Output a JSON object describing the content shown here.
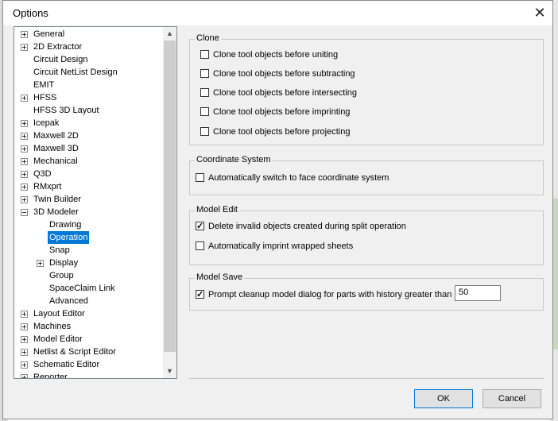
{
  "window": {
    "title": "Options",
    "close_glyph": "✕"
  },
  "tree": {
    "nodes": [
      {
        "label": "General",
        "expander": "plus",
        "indent": 0
      },
      {
        "label": "2D Extractor",
        "expander": "plus",
        "indent": 0
      },
      {
        "label": "Circuit Design",
        "expander": "none",
        "indent": 0
      },
      {
        "label": "Circuit NetList Design",
        "expander": "none",
        "indent": 0
      },
      {
        "label": "EMIT",
        "expander": "none",
        "indent": 0
      },
      {
        "label": "HFSS",
        "expander": "plus",
        "indent": 0
      },
      {
        "label": "HFSS 3D Layout",
        "expander": "none",
        "indent": 0
      },
      {
        "label": "Icepak",
        "expander": "plus",
        "indent": 0
      },
      {
        "label": "Maxwell 2D",
        "expander": "plus",
        "indent": 0
      },
      {
        "label": "Maxwell 3D",
        "expander": "plus",
        "indent": 0
      },
      {
        "label": "Mechanical",
        "expander": "plus",
        "indent": 0
      },
      {
        "label": "Q3D",
        "expander": "plus",
        "indent": 0
      },
      {
        "label": "RMxprt",
        "expander": "plus",
        "indent": 0
      },
      {
        "label": "Twin Builder",
        "expander": "plus",
        "indent": 0
      },
      {
        "label": "3D Modeler",
        "expander": "minus",
        "indent": 0
      },
      {
        "label": "Drawing",
        "expander": "none",
        "indent": 1
      },
      {
        "label": "Operation",
        "expander": "none",
        "indent": 1,
        "selected": true
      },
      {
        "label": "Snap",
        "expander": "none",
        "indent": 1
      },
      {
        "label": "Display",
        "expander": "plus",
        "indent": 1
      },
      {
        "label": "Group",
        "expander": "none",
        "indent": 1
      },
      {
        "label": "SpaceClaim Link",
        "expander": "none",
        "indent": 1
      },
      {
        "label": "Advanced",
        "expander": "none",
        "indent": 1
      },
      {
        "label": "Layout Editor",
        "expander": "plus",
        "indent": 0
      },
      {
        "label": "Machines",
        "expander": "plus",
        "indent": 0
      },
      {
        "label": "Model Editor",
        "expander": "plus",
        "indent": 0
      },
      {
        "label": "Netlist & Script Editor",
        "expander": "plus",
        "indent": 0
      },
      {
        "label": "Schematic Editor",
        "expander": "plus",
        "indent": 0
      },
      {
        "label": "Reporter",
        "expander": "plus",
        "indent": 0
      }
    ]
  },
  "clone": {
    "title": "Clone",
    "options": [
      {
        "label": "Clone tool objects before uniting",
        "checked": false
      },
      {
        "label": "Clone tool objects before subtracting",
        "checked": false
      },
      {
        "label": "Clone tool objects before intersecting",
        "checked": false
      },
      {
        "label": "Clone tool objects before imprinting",
        "checked": false
      },
      {
        "label": "Clone tool objects before projecting",
        "checked": false
      }
    ]
  },
  "coordinate_system": {
    "title": "Coordinate System",
    "options": [
      {
        "label": "Automatically switch to face coordinate system",
        "checked": false
      }
    ]
  },
  "model_edit": {
    "title": "Model Edit",
    "options": [
      {
        "label": "Delete invalid objects created during split operation",
        "checked": true
      },
      {
        "label": "Automatically imprint wrapped sheets",
        "checked": false
      }
    ]
  },
  "model_save": {
    "title": "Model Save",
    "options": [
      {
        "label": "Prompt cleanup model dialog for parts with history greater than",
        "checked": true
      }
    ],
    "history_limit": "50"
  },
  "buttons": {
    "ok": "OK",
    "cancel": "Cancel"
  }
}
